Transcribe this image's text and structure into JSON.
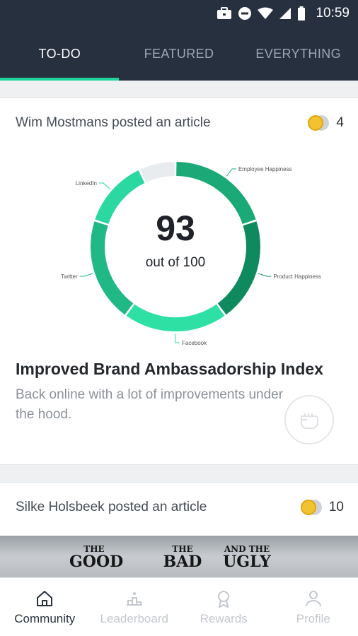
{
  "status_bar": {
    "time": "10:59",
    "icons": [
      "briefcase-icon",
      "do-not-disturb-icon",
      "wifi-icon",
      "signal-icon",
      "battery-icon"
    ]
  },
  "tabs": [
    {
      "label": "TO-DO",
      "active": true
    },
    {
      "label": "FEATURED",
      "active": false
    },
    {
      "label": "EVERYTHING",
      "active": false
    }
  ],
  "feed": [
    {
      "header": "Wim Mostmans posted an article",
      "coins": "4",
      "score": {
        "value": "93",
        "caption": "out of 100"
      },
      "title": "Improved Brand Ambassadorship Index",
      "description": "Back online with a lot of improvements under the hood."
    },
    {
      "header": "Silke Holsbeek posted an article",
      "coins": "10",
      "banner_words": [
        {
          "small": "THE",
          "big": "GOOD"
        },
        {
          "small": "THE",
          "big": "BAD"
        },
        {
          "small": "AND THE",
          "big": "UGLY"
        }
      ]
    }
  ],
  "chart_data": {
    "type": "pie",
    "style": "donut",
    "categories": [
      "Employee Happiness",
      "Product Happiness",
      "Facebook",
      "Twitter",
      "LinkedIn"
    ],
    "values": [
      20,
      20,
      20,
      20,
      13
    ],
    "remaining": 7,
    "total": 100,
    "colors": [
      "#1aa977",
      "#0f8a5f",
      "#2ee0a4",
      "#20b884",
      "#2ad8a0"
    ],
    "remaining_color": "#e8ecef"
  },
  "bottom_nav": [
    {
      "label": "Community",
      "icon": "home-icon",
      "active": true
    },
    {
      "label": "Leaderboard",
      "icon": "podium-icon",
      "active": false
    },
    {
      "label": "Rewards",
      "icon": "medal-icon",
      "active": false
    },
    {
      "label": "Profile",
      "icon": "person-icon",
      "active": false
    }
  ],
  "colors": {
    "header_bg": "#26303f",
    "accent": "#1ed49a",
    "coin": "#f3c230"
  }
}
